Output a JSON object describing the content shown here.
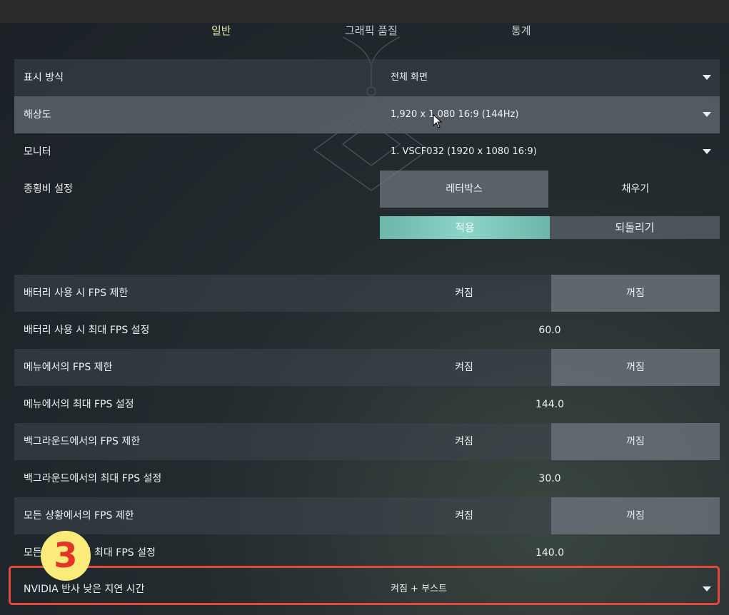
{
  "tabs": [
    "일반",
    "그래픽 품질",
    "통계"
  ],
  "active_tab": "일반",
  "display": {
    "display_mode": {
      "label": "표시 방식",
      "value": "전체 화면"
    },
    "resolution": {
      "label": "해상도",
      "value": "1,920 x 1,080 16:9 (144Hz)"
    },
    "monitor": {
      "label": "모니터",
      "value": "1. VSCF032 (1920 x  1080 16:9)"
    },
    "aspect_ratio": {
      "label": "종횡비 설정",
      "option_a": "레터박스",
      "option_b": "채우기",
      "selected": "레터박스"
    }
  },
  "buttons": {
    "apply": "적용",
    "revert": "되돌리기"
  },
  "fps": {
    "battery_limit": {
      "label": "배터리 사용 시 FPS 제한",
      "on": "켜짐",
      "off": "꺼짐",
      "selected": "꺼짐"
    },
    "battery_max": {
      "label": "배터리 사용 시 최대 FPS 설정",
      "value": "60.0"
    },
    "menu_limit": {
      "label": "메뉴에서의 FPS 제한",
      "on": "켜짐",
      "off": "꺼짐",
      "selected": "꺼짐"
    },
    "menu_max": {
      "label": "메뉴에서의 최대 FPS 설정",
      "value": "144.0"
    },
    "background_limit": {
      "label": "백그라운드에서의 FPS 제한",
      "on": "켜짐",
      "off": "꺼짐",
      "selected": "꺼짐"
    },
    "background_max": {
      "label": "백그라운드에서의 최대 FPS 설정",
      "value": "30.0"
    },
    "always_limit": {
      "label": "모든 상황에서의 FPS 제한",
      "on": "켜짐",
      "off": "꺼짐",
      "selected": "꺼짐"
    },
    "always_max": {
      "label": "모든 상황에서의 최대 FPS 설정",
      "value": "140.0"
    }
  },
  "nvidia_reflex": {
    "label": "NVIDIA 반사 낮은 지연 시간",
    "value": "켜짐 + 부스트"
  },
  "annotation": {
    "badge": "3",
    "highlight_color": "#e5473a",
    "badge_color": "#fbeb7a"
  },
  "colors": {
    "accent": "#7ec7bb",
    "active_tab": "#dfe7a8"
  }
}
